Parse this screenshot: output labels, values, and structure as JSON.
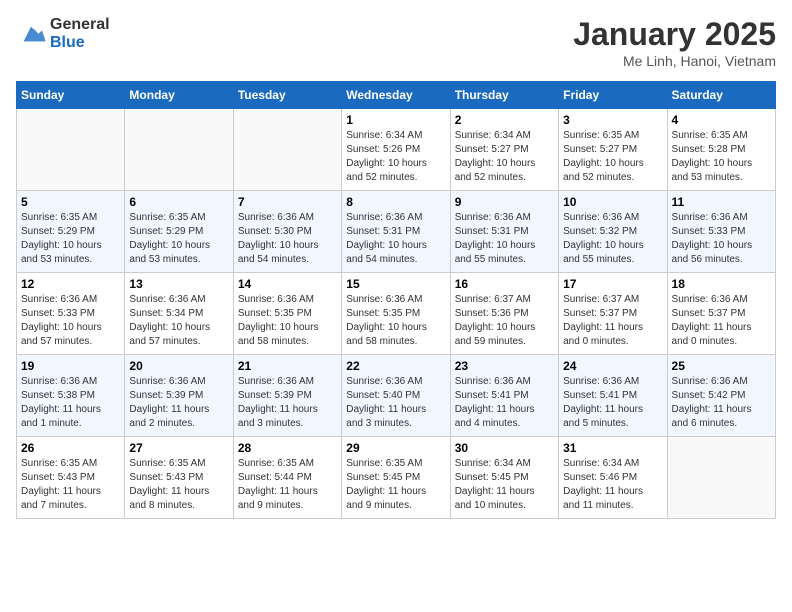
{
  "header": {
    "logo_general": "General",
    "logo_blue": "Blue",
    "month": "January 2025",
    "location": "Me Linh, Hanoi, Vietnam"
  },
  "weekdays": [
    "Sunday",
    "Monday",
    "Tuesday",
    "Wednesday",
    "Thursday",
    "Friday",
    "Saturday"
  ],
  "weeks": [
    [
      {
        "day": "",
        "info": ""
      },
      {
        "day": "",
        "info": ""
      },
      {
        "day": "",
        "info": ""
      },
      {
        "day": "1",
        "info": "Sunrise: 6:34 AM\nSunset: 5:26 PM\nDaylight: 10 hours\nand 52 minutes."
      },
      {
        "day": "2",
        "info": "Sunrise: 6:34 AM\nSunset: 5:27 PM\nDaylight: 10 hours\nand 52 minutes."
      },
      {
        "day": "3",
        "info": "Sunrise: 6:35 AM\nSunset: 5:27 PM\nDaylight: 10 hours\nand 52 minutes."
      },
      {
        "day": "4",
        "info": "Sunrise: 6:35 AM\nSunset: 5:28 PM\nDaylight: 10 hours\nand 53 minutes."
      }
    ],
    [
      {
        "day": "5",
        "info": "Sunrise: 6:35 AM\nSunset: 5:29 PM\nDaylight: 10 hours\nand 53 minutes."
      },
      {
        "day": "6",
        "info": "Sunrise: 6:35 AM\nSunset: 5:29 PM\nDaylight: 10 hours\nand 53 minutes."
      },
      {
        "day": "7",
        "info": "Sunrise: 6:36 AM\nSunset: 5:30 PM\nDaylight: 10 hours\nand 54 minutes."
      },
      {
        "day": "8",
        "info": "Sunrise: 6:36 AM\nSunset: 5:31 PM\nDaylight: 10 hours\nand 54 minutes."
      },
      {
        "day": "9",
        "info": "Sunrise: 6:36 AM\nSunset: 5:31 PM\nDaylight: 10 hours\nand 55 minutes."
      },
      {
        "day": "10",
        "info": "Sunrise: 6:36 AM\nSunset: 5:32 PM\nDaylight: 10 hours\nand 55 minutes."
      },
      {
        "day": "11",
        "info": "Sunrise: 6:36 AM\nSunset: 5:33 PM\nDaylight: 10 hours\nand 56 minutes."
      }
    ],
    [
      {
        "day": "12",
        "info": "Sunrise: 6:36 AM\nSunset: 5:33 PM\nDaylight: 10 hours\nand 57 minutes."
      },
      {
        "day": "13",
        "info": "Sunrise: 6:36 AM\nSunset: 5:34 PM\nDaylight: 10 hours\nand 57 minutes."
      },
      {
        "day": "14",
        "info": "Sunrise: 6:36 AM\nSunset: 5:35 PM\nDaylight: 10 hours\nand 58 minutes."
      },
      {
        "day": "15",
        "info": "Sunrise: 6:36 AM\nSunset: 5:35 PM\nDaylight: 10 hours\nand 58 minutes."
      },
      {
        "day": "16",
        "info": "Sunrise: 6:37 AM\nSunset: 5:36 PM\nDaylight: 10 hours\nand 59 minutes."
      },
      {
        "day": "17",
        "info": "Sunrise: 6:37 AM\nSunset: 5:37 PM\nDaylight: 11 hours\nand 0 minutes."
      },
      {
        "day": "18",
        "info": "Sunrise: 6:36 AM\nSunset: 5:37 PM\nDaylight: 11 hours\nand 0 minutes."
      }
    ],
    [
      {
        "day": "19",
        "info": "Sunrise: 6:36 AM\nSunset: 5:38 PM\nDaylight: 11 hours\nand 1 minute."
      },
      {
        "day": "20",
        "info": "Sunrise: 6:36 AM\nSunset: 5:39 PM\nDaylight: 11 hours\nand 2 minutes."
      },
      {
        "day": "21",
        "info": "Sunrise: 6:36 AM\nSunset: 5:39 PM\nDaylight: 11 hours\nand 3 minutes."
      },
      {
        "day": "22",
        "info": "Sunrise: 6:36 AM\nSunset: 5:40 PM\nDaylight: 11 hours\nand 3 minutes."
      },
      {
        "day": "23",
        "info": "Sunrise: 6:36 AM\nSunset: 5:41 PM\nDaylight: 11 hours\nand 4 minutes."
      },
      {
        "day": "24",
        "info": "Sunrise: 6:36 AM\nSunset: 5:41 PM\nDaylight: 11 hours\nand 5 minutes."
      },
      {
        "day": "25",
        "info": "Sunrise: 6:36 AM\nSunset: 5:42 PM\nDaylight: 11 hours\nand 6 minutes."
      }
    ],
    [
      {
        "day": "26",
        "info": "Sunrise: 6:35 AM\nSunset: 5:43 PM\nDaylight: 11 hours\nand 7 minutes."
      },
      {
        "day": "27",
        "info": "Sunrise: 6:35 AM\nSunset: 5:43 PM\nDaylight: 11 hours\nand 8 minutes."
      },
      {
        "day": "28",
        "info": "Sunrise: 6:35 AM\nSunset: 5:44 PM\nDaylight: 11 hours\nand 9 minutes."
      },
      {
        "day": "29",
        "info": "Sunrise: 6:35 AM\nSunset: 5:45 PM\nDaylight: 11 hours\nand 9 minutes."
      },
      {
        "day": "30",
        "info": "Sunrise: 6:34 AM\nSunset: 5:45 PM\nDaylight: 11 hours\nand 10 minutes."
      },
      {
        "day": "31",
        "info": "Sunrise: 6:34 AM\nSunset: 5:46 PM\nDaylight: 11 hours\nand 11 minutes."
      },
      {
        "day": "",
        "info": ""
      }
    ]
  ]
}
